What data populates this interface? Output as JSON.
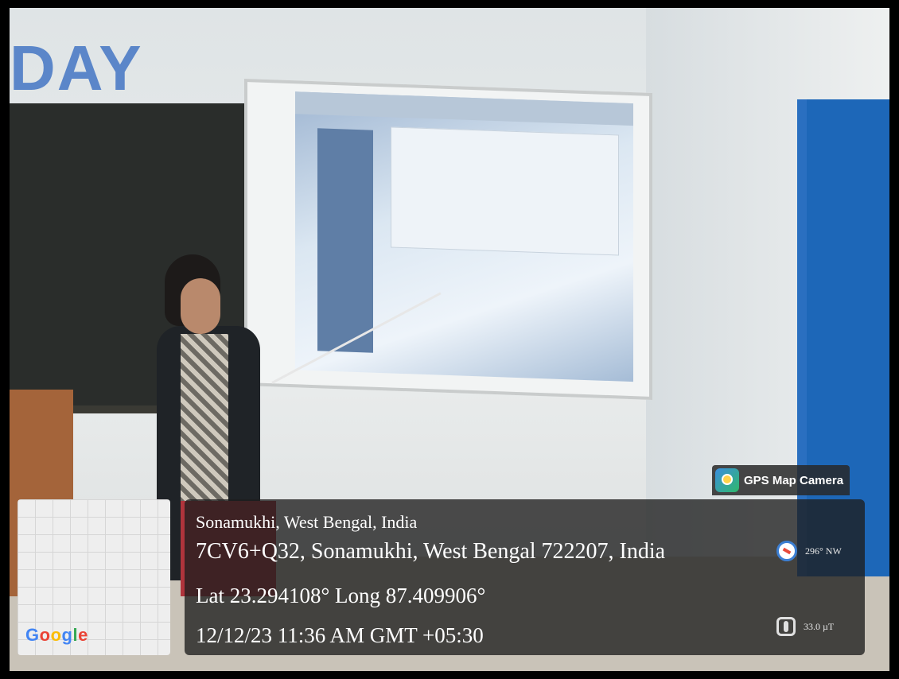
{
  "overlay": {
    "location_name": "Sonamukhi, West Bengal, India",
    "address": "7CV6+Q32, Sonamukhi, West Bengal 722207, India",
    "coordinates": "Lat 23.294108° Long 87.409906°",
    "datetime": "12/12/23 11:36 AM GMT +05:30",
    "compass_reading": "296° NW",
    "magnetic_reading": "33.0 µT"
  },
  "badge": {
    "app_name": "GPS Map Camera",
    "icon": "gps-map-camera-icon"
  },
  "map": {
    "logo_letters": [
      {
        "char": "G",
        "color": "#4285F4"
      },
      {
        "char": "o",
        "color": "#EA4335"
      },
      {
        "char": "o",
        "color": "#FBBC05"
      },
      {
        "char": "g",
        "color": "#4285F4"
      },
      {
        "char": "l",
        "color": "#34A853"
      },
      {
        "char": "e",
        "color": "#EA4335"
      }
    ]
  },
  "scene": {
    "banner_text": "DAY"
  }
}
